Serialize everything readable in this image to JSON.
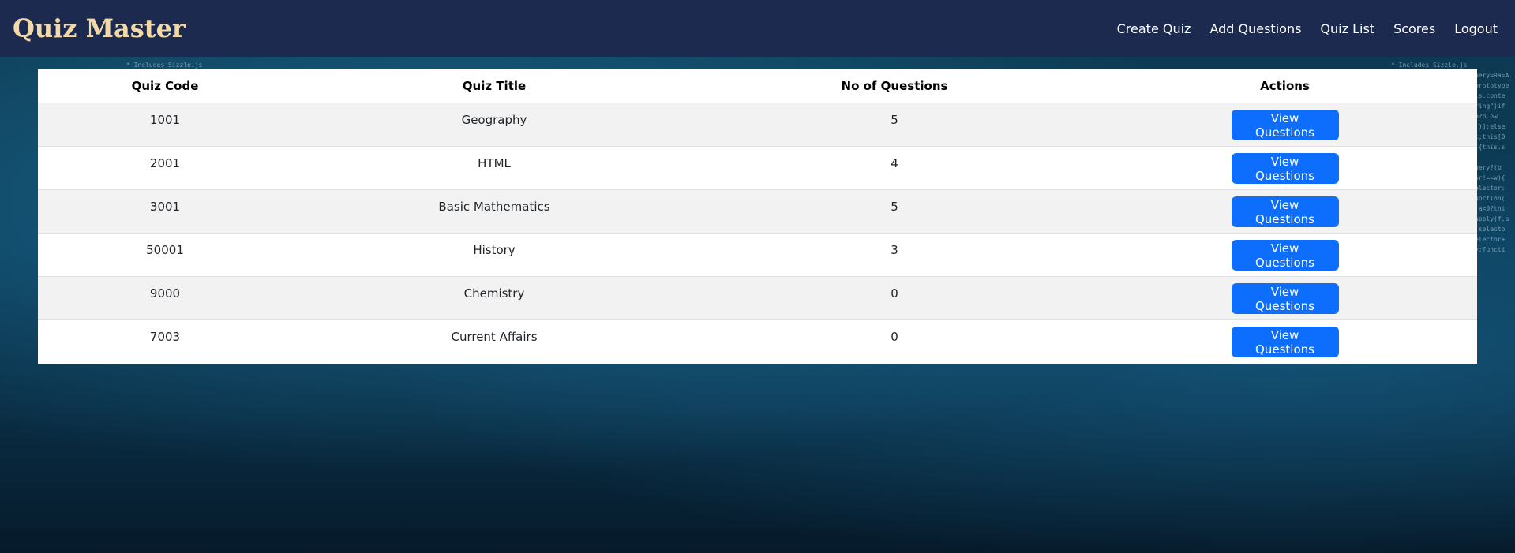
{
  "app": {
    "brand": "Quiz Master"
  },
  "nav": {
    "items": [
      {
        "label": "Create Quiz"
      },
      {
        "label": "Add Questions"
      },
      {
        "label": "Quiz List"
      },
      {
        "label": "Scores"
      },
      {
        "label": "Logout"
      }
    ]
  },
  "table": {
    "headers": [
      "Quiz Code",
      "Quiz Title",
      "No of Questions",
      "Actions"
    ],
    "rows": [
      {
        "code": "1001",
        "title": "Geography",
        "count": "5",
        "action": "View Questions"
      },
      {
        "code": "2001",
        "title": "HTML",
        "count": "4",
        "action": "View Questions"
      },
      {
        "code": "3001",
        "title": "Basic Mathematics",
        "count": "5",
        "action": "View Questions"
      },
      {
        "code": "50001",
        "title": "History",
        "count": "3",
        "action": "View Questions"
      },
      {
        "code": "9000",
        "title": "Chemistry",
        "count": "0",
        "action": "View Questions"
      },
      {
        "code": "7003",
        "title": "Current Affairs",
        "count": "0",
        "action": "View Questions"
      }
    ]
  },
  "background": {
    "code_left": "* Includes Sizzle.js\nc.fn.init(a,b)?Ra=A.jQuery=Ra=A.document=Ta=/^[^<]*(<[\\w\\W]+>)[^>]*$|^#([\\w-]+)$/\nWa=/^(\\s|\\u00A0)+|(\\s|\\u00A0)+$/g,Xa=/^<(\\w+)\\s*\\/?>(?:<\\/\\1>)?$/,Pa=navigator.userAgent\nrototype.slice,ya=Array.prototype.indexOf;c.fn=c.prototype={init:function(a,b){var d,f;if(!a)return\nthis;if(a.nodeType){this.context=this[0]=a;this.length=1;return\nthis}if(typeof a===\"string\")if((d=Ta.exec(a))&&\n(d[1]||!b))if(d[1]){f=b?b.ownerDocument||b:s;if(a=Xa.exec(a))if(c.isPlainObject(b))\na=[f.createElement(a[1])];else{a=sa([d[1]],[f]);a=(a.cacheable?a.fragment.cloneNode(true):a.fragment\nT.find(a);this.length=1;this[0]=b}this.context=s;this.selector=a;return this}else\nif(!b&&/^\\w+$/.test(a)){this.selector=a;this.context=s;a=s.getElementsByTagName(a);return\nc.merge(this,\na)}else return!b||b.jquery?(b||T).find(a):c(b).find(a);else if(c.isFunction(a))return\nT.ready(a);if(a.selector!==w){this.selector=a.selector;this.context=a.context}return\nc.makeArray(a,this)},selector:\"\",jquery:\"1.4.2\",length:0,size:function(){return\nthis.length},toArray:function(){return R.call(this,0)},get:function(a){return\na==null?this.toArray():a<0?this.slice(a)[0]:this[a]},pushStack:function(a,b,d){var\nf=c();c.isArray(a)?ba.apply(f,a):c.merge(f,a);f.prevObject=this;f.context=this.context;if(b===\n\"find\")f.selector=this.selector+(this.selector?\" \":\"\")+d;else\nif(b)f.selector=this.selector+\".\"+b+\"(\"+d+\")\";return f},each:function(a,b){return\nc.each(this,a,b)},ready:function(a){c.bindReady();if(c.isReady)a.call(s,c);else Q&&Q.push(a);return",
    "code_right": "* Includes Sizzle.js\nc.fn.init(a,b)?Ra=A.jQuery=Ra=A.\ntotype.slice,ya=Array.prototype\nthis;if(a.nodeType){this.conte\nthis}if(typeof a===\"string\")if\n(d[1]||!b))if(d[1]){f=b?b.ow\na=[f.createElement(a[1])];else\nT.find(a);this.length=1;this[0\nif(!b&&/^\\w+$/.test(a)){this.s\nc.merge(this,\na)}else return!b||b.jquery?(b\nT.ready(a);if(a.selector!==w){\nc.makeArray(a,this)},selector:\nthis.length},toArray:function(\na==null?this.toArray():a<0?thi\nf=c();c.isArray(a)?ba.apply(f,a\n\"find\")f.selector=this.selecto\nif(b)f.selector=this.selector+\nc.each(this,a,b)},ready:functi"
  }
}
